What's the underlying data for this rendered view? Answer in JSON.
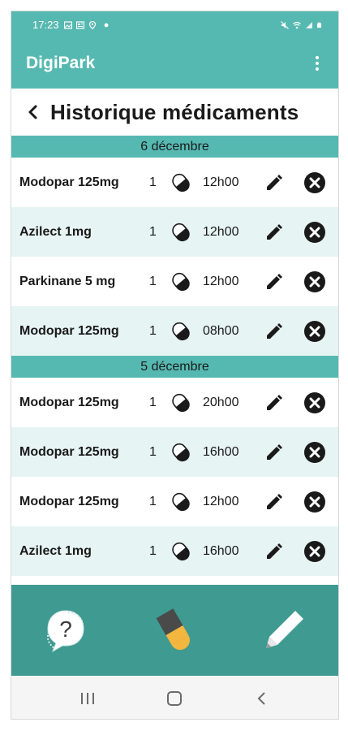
{
  "status_bar": {
    "time": "17:23",
    "icons_left": [
      "image-icon",
      "news-icon",
      "location-icon",
      "dot-icon"
    ],
    "icons_right": [
      "mute-icon",
      "wifi-icon",
      "signal-icon",
      "battery-icon"
    ]
  },
  "app_bar": {
    "title": "DigiPark",
    "menu_icon": "more-vert-icon"
  },
  "header": {
    "back_icon": "chevron-left-icon",
    "title": "Historique médicaments"
  },
  "groups": [
    {
      "date": "6 décembre",
      "entries": [
        {
          "name": "Modopar 125mg",
          "qty": "1",
          "time": "12h00"
        },
        {
          "name": "Azilect 1mg",
          "qty": "1",
          "time": "12h00"
        },
        {
          "name": "Parkinane 5 mg",
          "qty": "1",
          "time": "12h00"
        },
        {
          "name": "Modopar 125mg",
          "qty": "1",
          "time": "08h00"
        }
      ]
    },
    {
      "date": "5 décembre",
      "entries": [
        {
          "name": "Modopar 125mg",
          "qty": "1",
          "time": "20h00"
        },
        {
          "name": "Modopar 125mg",
          "qty": "1",
          "time": "16h00"
        },
        {
          "name": "Modopar 125mg",
          "qty": "1",
          "time": "12h00"
        },
        {
          "name": "Azilect 1mg",
          "qty": "1",
          "time": "16h00"
        }
      ]
    }
  ],
  "row_icons": {
    "pill": "pill-icon",
    "edit": "pencil-icon",
    "delete": "close-circle-icon"
  },
  "bottom_nav": [
    {
      "name": "help",
      "icon": "help-bubble-icon"
    },
    {
      "name": "medication",
      "icon": "capsule-icon"
    },
    {
      "name": "notes",
      "icon": "pencil-icon"
    }
  ],
  "system_nav": [
    "recents-icon",
    "home-icon",
    "back-icon"
  ],
  "colors": {
    "primary": "#56b9b1",
    "primary_dark": "#3f9a91",
    "row_alt": "#e6f4f3",
    "capsule_yellow": "#f3b63f",
    "capsule_dark": "#4a4a4a"
  }
}
